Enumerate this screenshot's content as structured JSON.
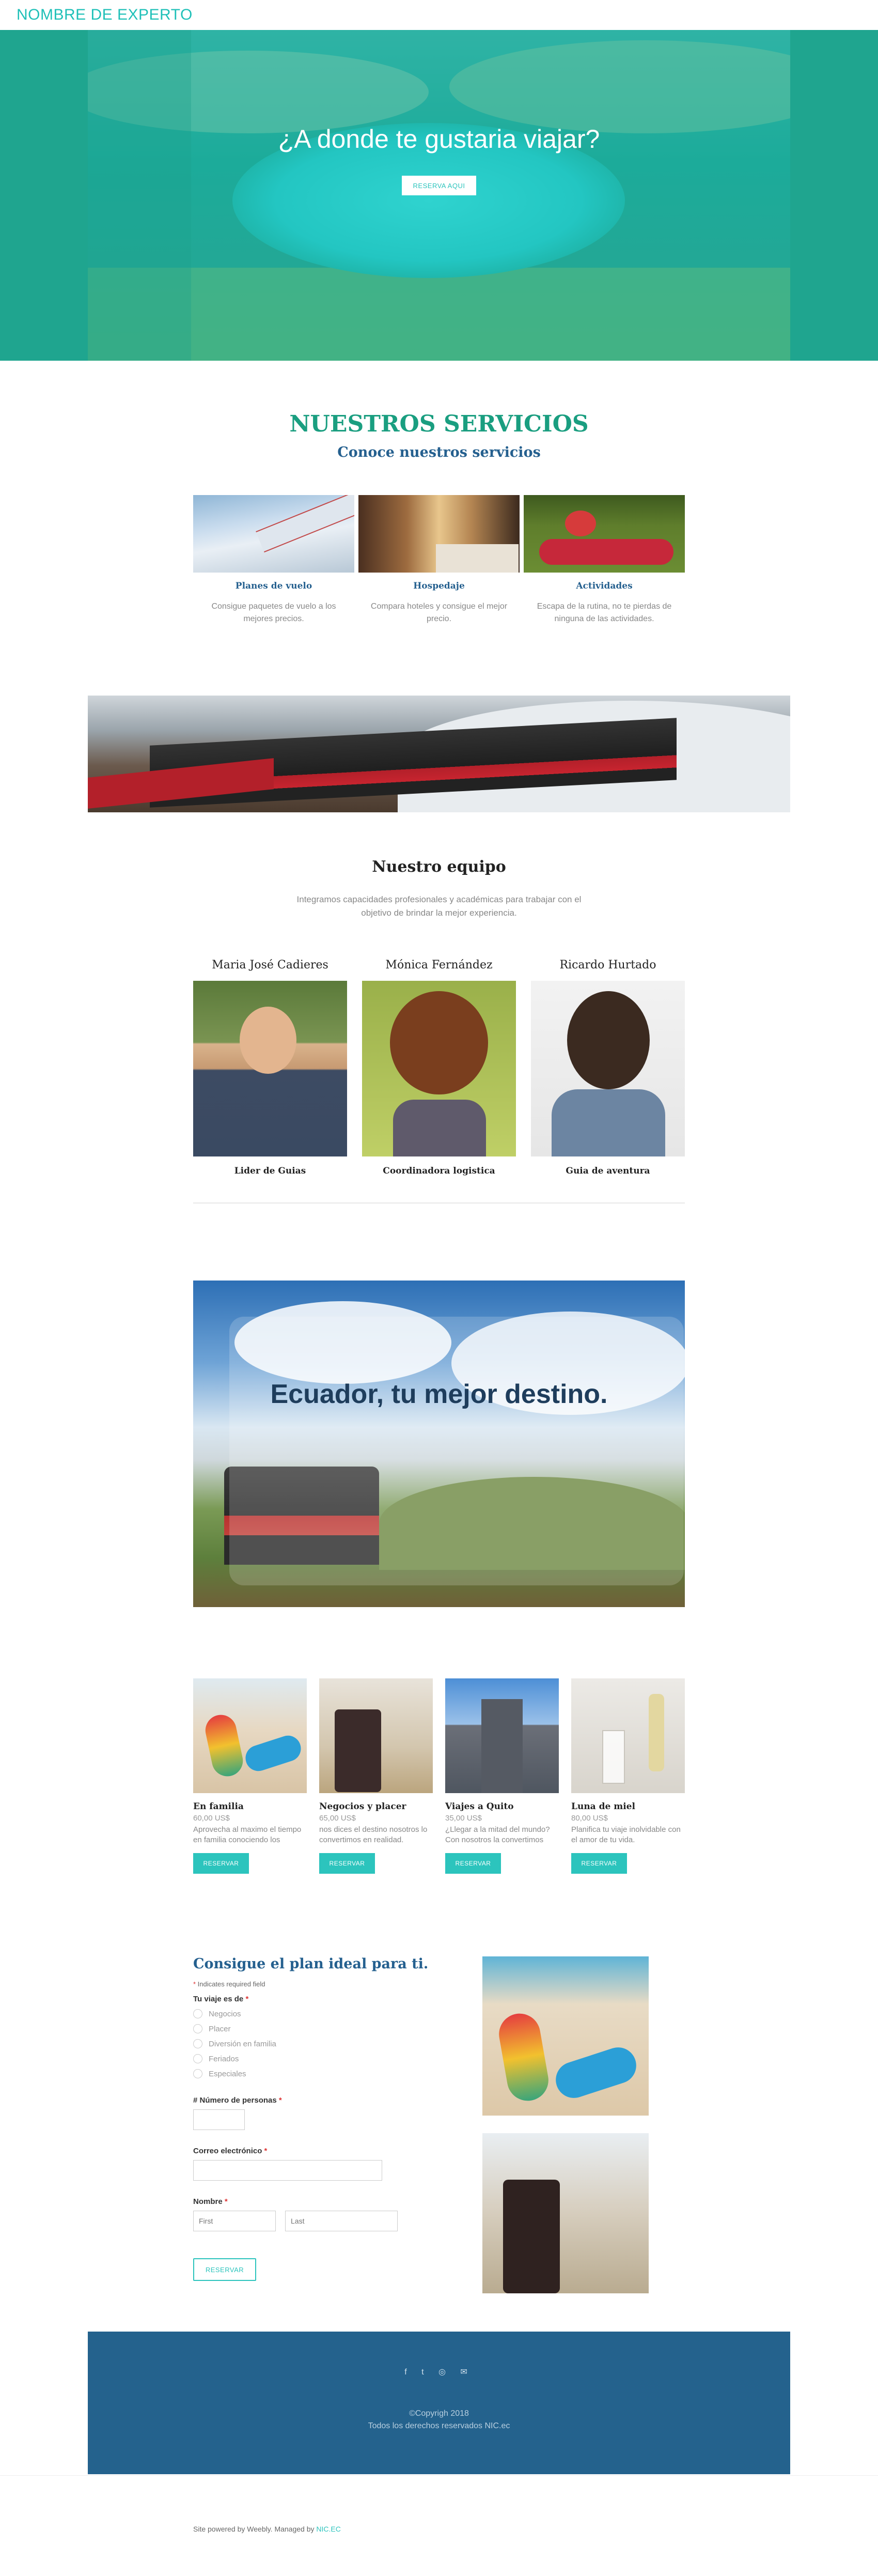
{
  "header": {
    "site_title": "NOMBRE DE EXPERTO"
  },
  "hero": {
    "heading": "¿A donde te gustaria viajar?",
    "button_label": "RESERVA AQUI"
  },
  "services": {
    "title": "NUESTROS SERVICIOS",
    "subtitle": "Conoce nuestros servicios",
    "items": [
      {
        "name": "Planes de vuelo",
        "desc": "Consigue paquetes de vuelo a los mejores precios."
      },
      {
        "name": "Hospedaje",
        "desc": "Compara hoteles y consigue el mejor precio."
      },
      {
        "name": "Actividades",
        "desc": "Escapa de la rutina, no te pierdas de ninguna de las actividades."
      }
    ]
  },
  "team": {
    "title": "Nuestro equipo",
    "desc": "Integramos capacidades profesionales y académicas para trabajar con el objetivo de brindar la mejor experiencia.",
    "members": [
      {
        "name": "Maria José Cadieres",
        "role": "Lider de Guias"
      },
      {
        "name": "Mónica Fernández",
        "role": "Coordinadora logistica"
      },
      {
        "name": "Ricardo Hurtado",
        "role": "Guia de aventura"
      }
    ]
  },
  "feature": {
    "text": "Ecuador, tu mejor destino."
  },
  "tours": [
    {
      "title": "En familia",
      "price": "60,00 US$",
      "desc": "Aprovecha al maximo el tiempo en familia conociendo los",
      "button": "RESERVAR"
    },
    {
      "title": "Negocios y placer",
      "price": "65,00 US$",
      "desc": "nos dices el destino nosotros lo convertimos en realidad.",
      "button": "RESERVAR"
    },
    {
      "title": "Viajes a Quito",
      "price": "35,00 US$",
      "desc": "¿Llegar a la mitad del mundo? Con nosotros la convertimos",
      "button": "RESERVAR"
    },
    {
      "title": "Luna de miel",
      "price": "80,00 US$",
      "desc": "Planifica tu viaje inolvidable con el amor de tu vida.",
      "button": "RESERVAR"
    }
  ],
  "form": {
    "title": "Consigue el plan ideal para ti.",
    "required_note": "Indicates required field",
    "trip_label": "Tu viaje es de",
    "trip_options": [
      "Negocios",
      "Placer",
      "Diversión en familia",
      "Feriados",
      "Especiales"
    ],
    "persons_label": "# Número de personas",
    "email_label": "Correo electrónico",
    "name_label": "Nombre",
    "first_placeholder": "First",
    "last_placeholder": "Last",
    "submit_label": "RESERVAR"
  },
  "footer": {
    "social_icons": [
      "facebook-icon",
      "twitter-icon",
      "instagram-icon",
      "email-icon"
    ],
    "social_glyphs": "f  t  ◎  ✉",
    "copyright": "©Copyrigh 2018",
    "rights": "Todos los derechos reservados NIC.ec",
    "powered_text": "Site powered by Weebly. Managed by ",
    "powered_link": "NIC.EC"
  },
  "colors": {
    "accent": "#2cc4bd",
    "heading_green": "#1a9e80",
    "heading_blue": "#25608f",
    "footer_bg": "#24628d"
  }
}
